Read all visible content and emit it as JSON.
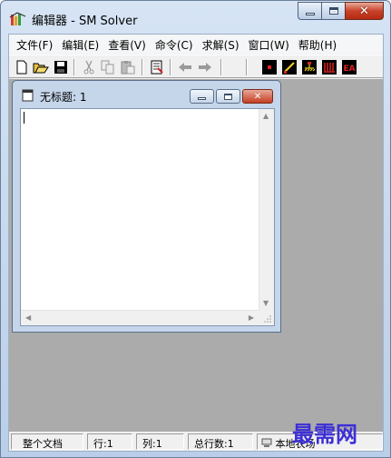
{
  "window": {
    "title": "编辑器 - SM Solver"
  },
  "menu": {
    "items": [
      "文件(F)",
      "编辑(E)",
      "查看(V)",
      "命令(C)",
      "求解(S)",
      "窗口(W)",
      "帮助(H)"
    ]
  },
  "toolbar": {
    "buttons": [
      "new-file",
      "open-folder",
      "save",
      "cut",
      "copy",
      "paste",
      "print-preview",
      "undo-back",
      "redo-forward",
      "point-tool",
      "line-tool",
      "ground-tool",
      "comb-tool",
      "ea-tool"
    ],
    "ea_label": "EA"
  },
  "child_window": {
    "title": "无标题: 1",
    "content": ""
  },
  "statusbar": {
    "scope": "整个文档",
    "row": "行:1",
    "col": "列:1",
    "total": "总行数:1",
    "location": "本地农场"
  },
  "watermark": "最需网",
  "colors": {
    "mdi_bg": "#ababab",
    "watermark": "#3d2fd6",
    "close_red": "#c8432a"
  }
}
